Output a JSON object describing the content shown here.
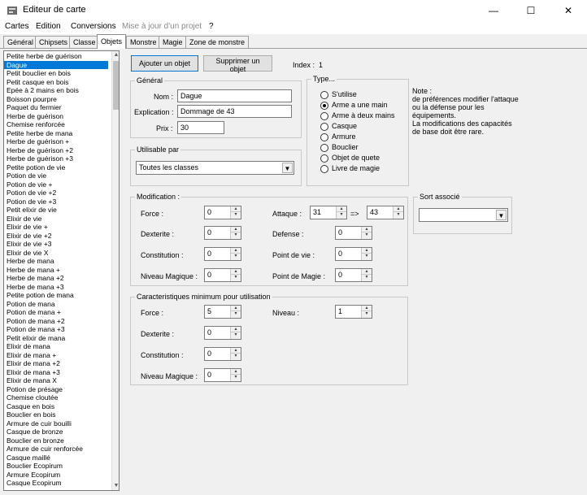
{
  "window": {
    "title": "Editeur de carte",
    "minimize": "—",
    "maximize": "☐",
    "close": "✕"
  },
  "menu": [
    {
      "label": "Cartes",
      "enabled": true
    },
    {
      "label": "Edition",
      "enabled": true
    },
    {
      "label": "Conversions",
      "enabled": true
    },
    {
      "label": "Mise à jour d'un projet",
      "enabled": false
    },
    {
      "label": "?",
      "enabled": true
    }
  ],
  "tabs": [
    "Général",
    "Chipsets",
    "Classe",
    "Objets",
    "Monstre",
    "Magie",
    "Zone de monstre"
  ],
  "active_tab": "Objets",
  "items": [
    "Petite herbe de guérison",
    "Dague",
    "Petit bouclier en bois",
    "Petit casque en bois",
    "Epée à 2 mains en bois",
    "Boisson pourpre",
    "Paquet du fermier",
    "Herbe de guérison",
    "Chemise renforcée",
    "Petite herbe de mana",
    "Herbe de guérison +",
    "Herbe de guérison +2",
    "Herbe de guérison +3",
    "Petite potion de vie",
    "Potion de vie",
    "Potion de vie +",
    "Potion de vie +2",
    "Potion de vie +3",
    "Petit elixir de vie",
    "Elixir de vie",
    "Elixir de vie +",
    "Elixir de vie +2",
    "Elixir de vie +3",
    "Elixir de vie X",
    "Herbe de mana",
    "Herbe de mana +",
    "Herbe de mana +2",
    "Herbe de mana +3",
    "Petite potion de mana",
    "Potion de mana",
    "Potion de mana +",
    "Potion de mana +2",
    "Potion de mana +3",
    "Petit elixir de mana",
    "Elixir de mana",
    "Elixir de mana +",
    "Elixir de mana +2",
    "Elixir de mana +3",
    "Elixir de mana X",
    "Potion de présage",
    "Chemise cloutée",
    "Casque en bois",
    "Bouclier en bois",
    "Armure de cuir bouilli",
    "Casque de bronze",
    "Bouclier en bronze",
    "Armure de cuir renforcée",
    "Casque maillé",
    "Bouclier Ecopirum",
    "Armure Ecopirum",
    "Casque Ecopirum"
  ],
  "selected_index": 1,
  "scroll": {
    "up": "▲",
    "down": "▼"
  },
  "actions": {
    "add": "Ajouter un objet",
    "delete": "Supprimer un objet"
  },
  "index": {
    "label": "Index :",
    "value": "1"
  },
  "general": {
    "title": "Général",
    "name_label": "Nom :",
    "name_value": "Dague",
    "explanation_label": "Explication :",
    "explanation_value": "Dommage de 43",
    "price_label": "Prix :",
    "price_value": "30"
  },
  "type": {
    "title": "Type...",
    "options": [
      "S'utilise",
      "Arme a une main",
      "Arme à deux mains",
      "Casque",
      "Armure",
      "Bouclier",
      "Objet de quete",
      "Livre de magie"
    ],
    "selected": 1
  },
  "note": {
    "lines": [
      "Note :",
      "de préférences modifier l'attaque",
      "ou la défense pour les",
      "équipements.",
      "La modifications des capacités",
      "de base doit être rare."
    ]
  },
  "usable": {
    "title": "Utilisable par",
    "value": "Toutes les classes"
  },
  "modification": {
    "title": "Modification :",
    "force_label": "Force :",
    "force": "0",
    "dexterite_label": "Dexterite :",
    "dexterite": "0",
    "constitution_label": "Constitution :",
    "constitution": "0",
    "niveau_magique_label": "Niveau Magique :",
    "niveau_magique": "0",
    "attaque_label": "Attaque :",
    "attaque": "31",
    "arrow": "=>",
    "attaque_result": "43",
    "defense_label": "Defense :",
    "defense": "0",
    "point_vie_label": "Point de vie :",
    "point_vie": "0",
    "point_magie_label": "Point de Magie :",
    "point_magie": "0"
  },
  "minimum": {
    "title": "Caracteristiques minimum pour utilisation",
    "force_label": "Force :",
    "force": "5",
    "dexterite_label": "Dexterite :",
    "dexterite": "0",
    "constitution_label": "Constitution :",
    "constitution": "0",
    "niveau_magique_label": "Niveau Magique :",
    "niveau_magique": "0",
    "niveau_label": "Niveau :",
    "niveau": "1"
  },
  "sort": {
    "title": "Sort associé",
    "value": ""
  },
  "spin": {
    "up": "▴",
    "down": "▾"
  },
  "combo_arrow": "▼"
}
